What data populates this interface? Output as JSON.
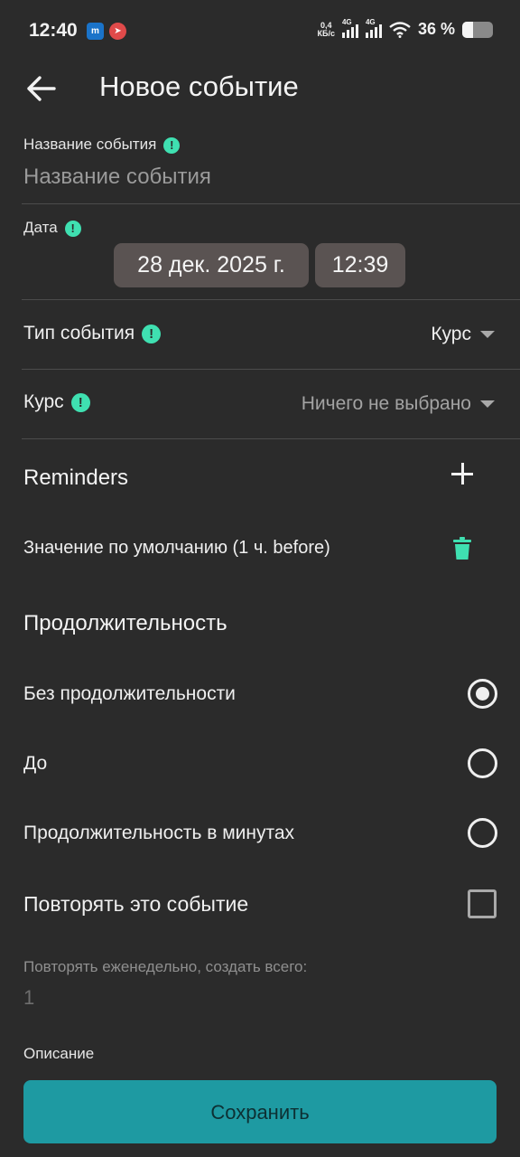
{
  "status_bar": {
    "time": "12:40",
    "net_speed_value": "0,4",
    "net_speed_unit": "КБ/с",
    "signal_1_label": "4G",
    "signal_2_label": "4G",
    "battery_text": "36 %",
    "battery_level_percent": 36
  },
  "toolbar": {
    "title": "Новое событие"
  },
  "form": {
    "event_name_label": "Название события",
    "event_name_placeholder": "Название события",
    "date_label": "Дата",
    "date_value": "28 дек. 2025 г.",
    "time_value": "12:39",
    "event_type_label": "Тип события",
    "event_type_value": "Курс",
    "course_label": "Курс",
    "course_value": "Ничего не выбрано"
  },
  "reminders": {
    "title": "Reminders",
    "items": [
      "Значение по умолчанию (1 ч. before)"
    ]
  },
  "duration": {
    "title": "Продолжительность",
    "options": [
      "Без продолжительности",
      "До",
      "Продолжительность в минутах"
    ],
    "selected_index": 0
  },
  "repeat": {
    "label": "Повторять это событие",
    "checked": false,
    "weekly_label": "Повторять еженедельно, создать всего:",
    "count_placeholder": "1"
  },
  "description": {
    "label": "Описание"
  },
  "save_button": {
    "label": "Сохранить"
  },
  "colors": {
    "background": "#2b2b2b",
    "accent_green": "#3fe0b1",
    "button_teal": "#1e9aa2",
    "chip_bg": "#5a5352"
  }
}
